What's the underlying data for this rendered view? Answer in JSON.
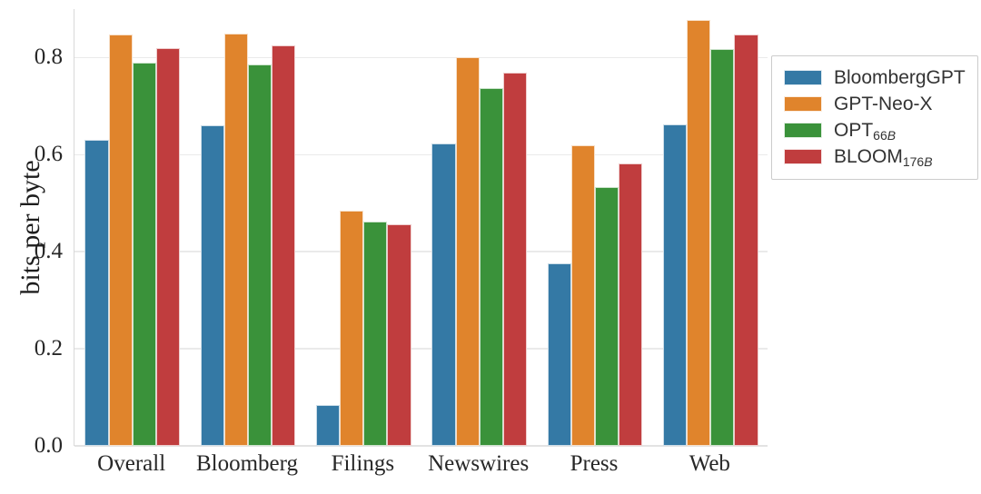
{
  "chart_data": {
    "type": "bar",
    "title": "",
    "xlabel": "",
    "ylabel": "bits per byte",
    "categories": [
      "Overall",
      "Bloomberg",
      "Filings",
      "Newswires",
      "Press",
      "Web"
    ],
    "series": [
      {
        "name": "BloombergGPT",
        "color": "#3479a5",
        "values": [
          0.631,
          0.66,
          0.085,
          0.623,
          0.377,
          0.663
        ]
      },
      {
        "name": "GPT-Neo-X",
        "color": "#e0842c",
        "values": [
          0.848,
          0.849,
          0.485,
          0.8,
          0.62,
          0.877
        ]
      },
      {
        "name": "OPT",
        "subscript": "66B",
        "color": "#3a923a",
        "values": [
          0.789,
          0.786,
          0.463,
          0.737,
          0.533,
          0.817
        ]
      },
      {
        "name": "BLOOM",
        "subscript": "176B",
        "color": "#c03d3e",
        "values": [
          0.82,
          0.825,
          0.457,
          0.769,
          0.582,
          0.848
        ]
      }
    ],
    "ylim": [
      0.0,
      0.9
    ],
    "yticks": [
      0.0,
      0.2,
      0.4,
      0.6,
      0.8
    ],
    "ytick_labels": [
      "0.0",
      "0.2",
      "0.4",
      "0.6",
      "0.8"
    ],
    "grid": true,
    "grid_axis": "y",
    "grid_color": "#eaeaea",
    "legend_position": "upper right",
    "legend_entries": [
      {
        "label": "BloombergGPT",
        "subscript": "",
        "color": "#3479a5"
      },
      {
        "label": "GPT-Neo-X",
        "subscript": "",
        "color": "#e0842c"
      },
      {
        "label": "OPT",
        "subscript": "66B",
        "color": "#3a923a"
      },
      {
        "label": "BLOOM",
        "subscript": "176B",
        "color": "#c03d3e"
      }
    ],
    "background_color": "#ffffff",
    "axis_color": "#d8d8d8"
  }
}
